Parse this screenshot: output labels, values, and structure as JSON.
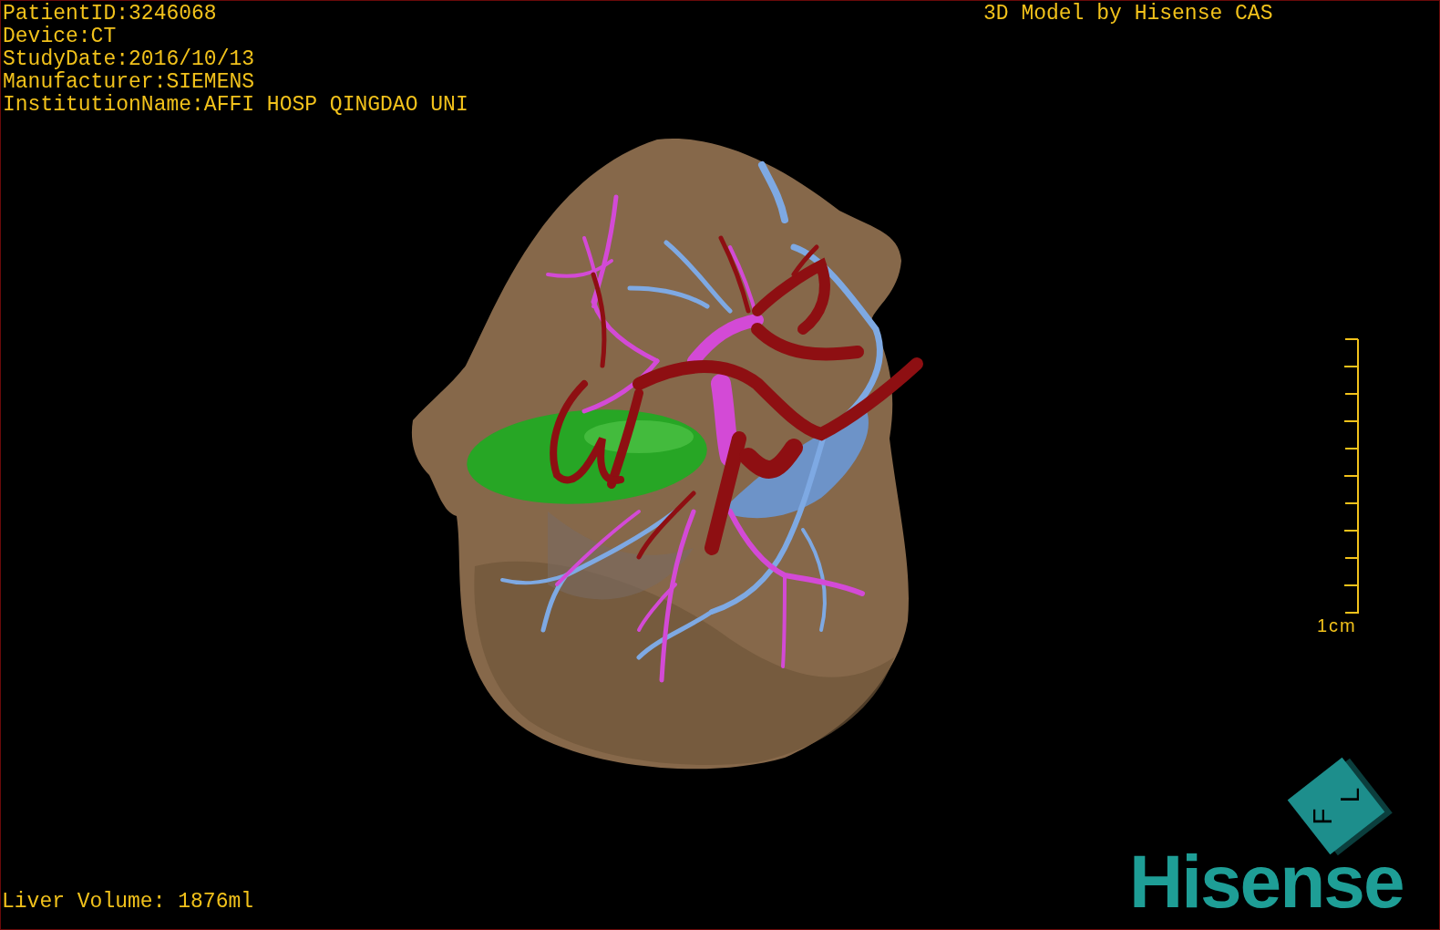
{
  "info_lines": [
    "PatientID:3246068",
    "Device:CT",
    "StudyDate:2016/10/13",
    "Manufacturer:SIEMENS",
    "InstitutionName:AFFI HOSP QINGDAO UNI"
  ],
  "title": "3D Model by Hisense CAS",
  "scale_bar": {
    "label": "1cm"
  },
  "liver_volume": "Liver Volume: 1876ml",
  "orientation_cube": {
    "labels": [
      "F",
      "L"
    ]
  },
  "logo": "Hisense"
}
